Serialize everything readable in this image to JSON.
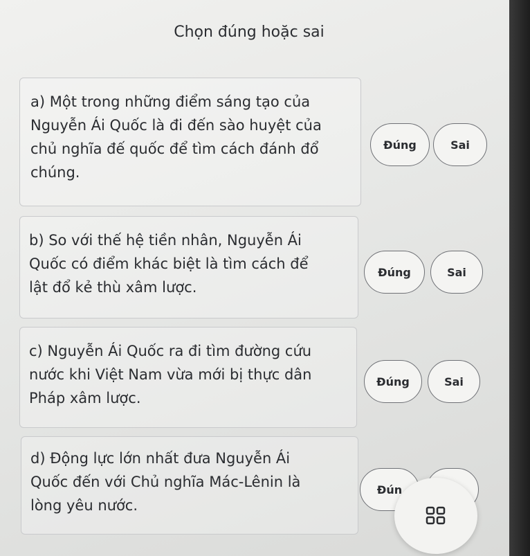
{
  "page": {
    "title": "Chọn đúng hoặc sai"
  },
  "questions": [
    {
      "lines": [
        "a) Một trong những điểm sáng tạo của",
        "Nguyễn Ái Quốc là đi đến sào huyệt của",
        "chủ nghĩa đế quốc để tìm cách đánh đổ",
        "chúng."
      ],
      "true_label": "Đúng",
      "false_label": "Sai"
    },
    {
      "lines": [
        "b) So với thế hệ tiền nhân, Nguyễn Ái",
        "Quốc có điểm khác biệt là tìm cách để",
        "lật đổ kẻ thù xâm lược."
      ],
      "true_label": "Đúng",
      "false_label": "Sai"
    },
    {
      "lines": [
        "c) Nguyễn Ái Quốc ra đi tìm đường cứu",
        "nước khi Việt Nam vừa mới bị thực dân",
        "Pháp xâm lược."
      ],
      "true_label": "Đúng",
      "false_label": "Sai"
    },
    {
      "lines": [
        "d) Động lực lớn nhất đưa Nguyễn Ái",
        "Quốc đến với Chủ nghĩa Mác-Lênin là",
        "lòng yêu nước."
      ],
      "true_label": "Đún",
      "false_label": ""
    }
  ],
  "fab": {
    "icon": "grid-icon"
  }
}
